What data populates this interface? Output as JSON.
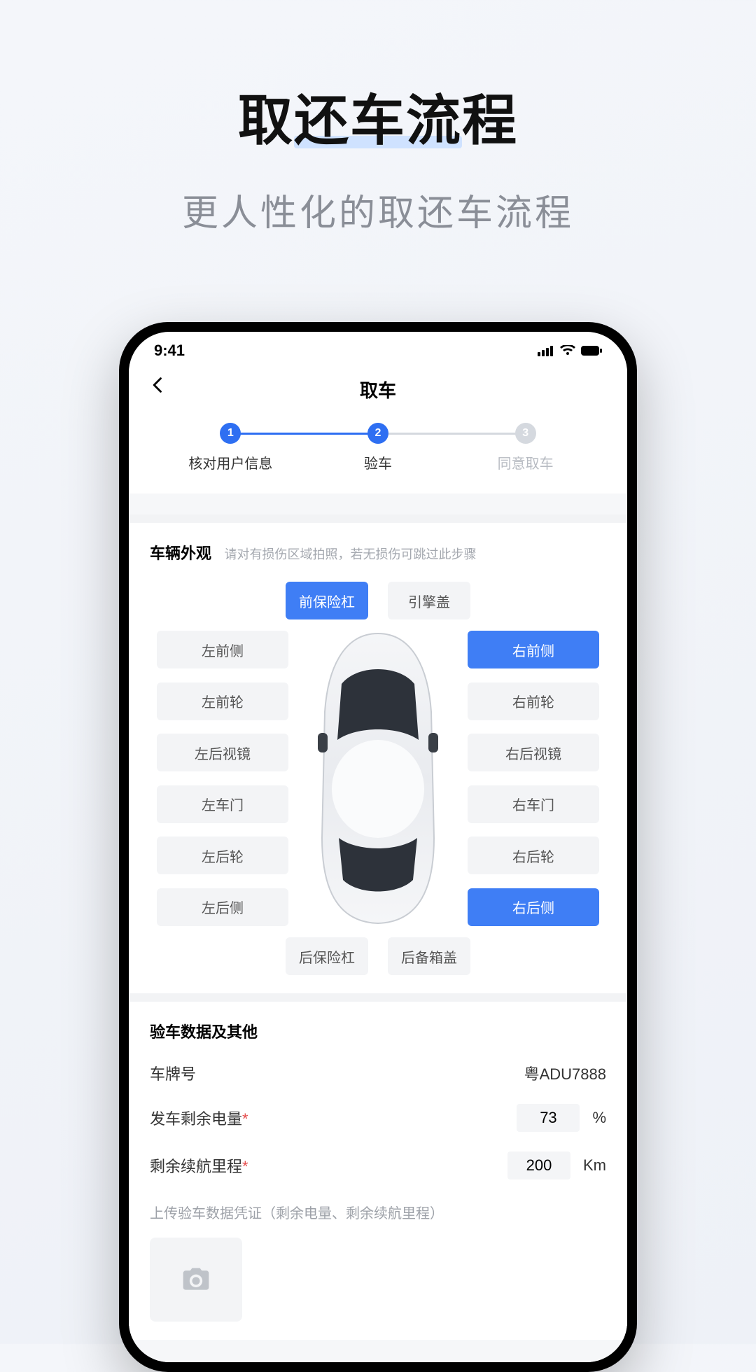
{
  "hero": {
    "title": "取还车流程",
    "subtitle": "更人性化的取还车流程"
  },
  "status": {
    "time": "9:41"
  },
  "nav": {
    "title": "取车"
  },
  "steps": [
    {
      "num": "1",
      "label": "核对用户信息",
      "active": true
    },
    {
      "num": "2",
      "label": "验车",
      "active": true
    },
    {
      "num": "3",
      "label": "同意取车",
      "active": false
    }
  ],
  "exterior": {
    "title": "车辆外观",
    "hint": "请对有损伤区域拍照，若无损伤可跳过此步骤",
    "top": [
      {
        "name": "前保险杠",
        "active": true
      },
      {
        "name": "引擎盖",
        "active": false
      }
    ],
    "left": [
      {
        "name": "左前侧",
        "active": false
      },
      {
        "name": "左前轮",
        "active": false
      },
      {
        "name": "左后视镜",
        "active": false
      },
      {
        "name": "左车门",
        "active": false
      },
      {
        "name": "左后轮",
        "active": false
      },
      {
        "name": "左后侧",
        "active": false
      }
    ],
    "right": [
      {
        "name": "右前侧",
        "active": true
      },
      {
        "name": "右前轮",
        "active": false
      },
      {
        "name": "右后视镜",
        "active": false
      },
      {
        "name": "右车门",
        "active": false
      },
      {
        "name": "右后轮",
        "active": false
      },
      {
        "name": "右后侧",
        "active": true
      }
    ],
    "bottom": [
      {
        "name": "后保险杠",
        "active": false
      },
      {
        "name": "后备箱盖",
        "active": false
      }
    ]
  },
  "data_section": {
    "title": "验车数据及其他",
    "plate_label": "车牌号",
    "plate_value": "粤ADU7888",
    "battery_label": "发车剩余电量",
    "battery_value": "73",
    "battery_unit": "%",
    "range_label": "剩余续航里程",
    "range_value": "200",
    "range_unit": "Km",
    "upload_caption": "上传验车数据凭证（剩余电量、剩余续航里程）"
  }
}
